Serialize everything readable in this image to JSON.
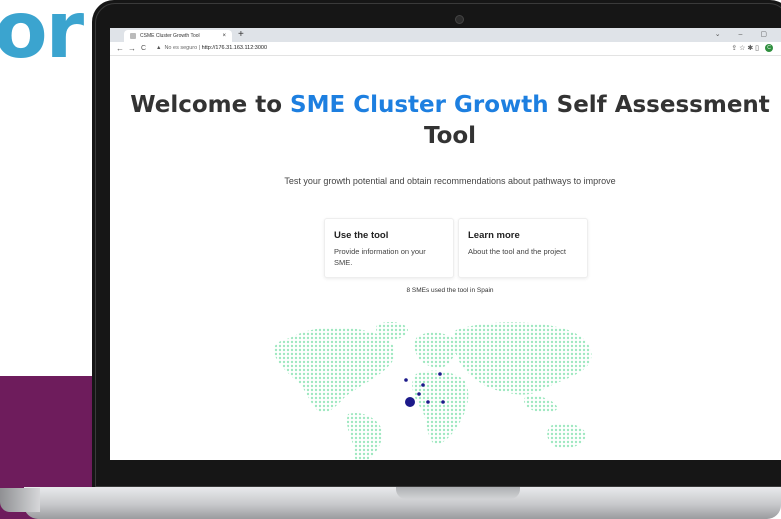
{
  "background": {
    "big_word": "or"
  },
  "colors": {
    "accent": "#1d7fe0",
    "map_dot": "#9fe8c0",
    "marker": "#1c1a8a",
    "brand_purple": "#6e1c5c",
    "brand_teal": "#3ba4cf"
  },
  "browser": {
    "tab_title": "CSME Cluster Growth Tool",
    "tab_close": "×",
    "new_tab": "+",
    "window_controls": "⌄ – ▢",
    "nav": {
      "back": "←",
      "forward": "→",
      "reload": "C"
    },
    "security_label": "No es seguro",
    "url": "http://176.31.163.112:3000",
    "toolbar_icons": "⇪ ☆ ✱ ▯",
    "profile_initial": "C"
  },
  "page": {
    "title_prefix": "Welcome to ",
    "title_accent": "SME Cluster Growth",
    "title_suffix": " Self Assessment Tool",
    "subtitle": "Test your growth potential and obtain recommendations about pathways to improve",
    "cards": [
      {
        "title": "Use the tool",
        "description": "Provide information on your SME."
      },
      {
        "title": "Learn more",
        "description": "About the tool and the project"
      }
    ],
    "usage_text": "8 SMEs used the tool in Spain"
  }
}
